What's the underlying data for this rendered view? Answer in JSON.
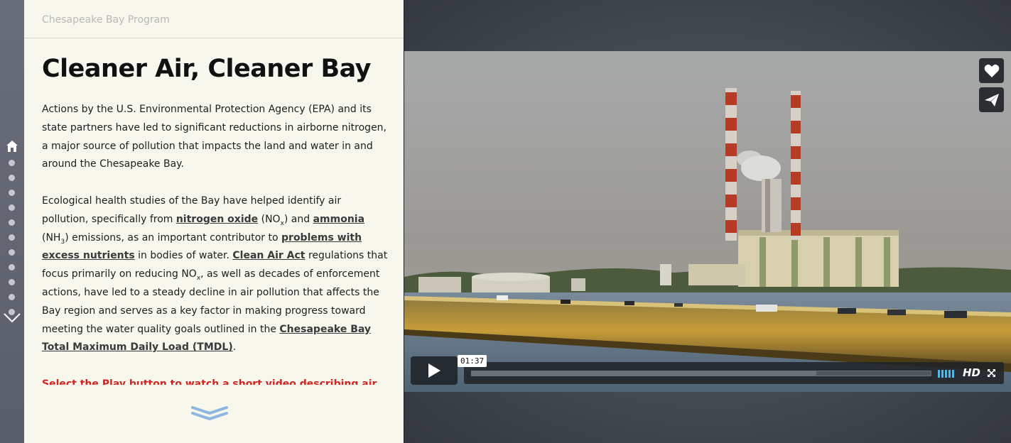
{
  "site": {
    "brand": "Chesapeake Bay Program"
  },
  "story": {
    "title": "Cleaner Air, Cleaner Bay",
    "p1": "Actions by the U.S. Environmental Protection Agency (EPA) and its state partners have led to significant reductions in airborne nitrogen, a major source of pollution that impacts the land and water in and around the Chesapeake Bay.",
    "p2": {
      "t1": "Ecological health studies of the Bay have helped identify air pollution, specifically from ",
      "link1": "nitrogen oxide",
      "t2": " (NO",
      "sub1": "x",
      "t3": ") and ",
      "link2": "ammonia",
      "t4": " (NH",
      "sub2": "3",
      "t5": ") emissions, as an important contributor to ",
      "link3": "problems with excess nutrients",
      "t6": " in bodies of water. ",
      "link4": "Clean Air Act",
      "t7": " regulations that focus primarily on reducing NO",
      "sub3": "x",
      "t8": ", as well as decades of enforcement actions, have led to a steady decline in air pollution that affects the Bay region and serves as a key factor in making progress toward meeting the water quality goals outlined in the ",
      "link5": "Chesapeake Bay Total Maximum Daily Load (TMDL)",
      "t9": "."
    },
    "cta": "Select the Play button to watch a short video describing air pollution and the Chesapeake Bay"
  },
  "nav": {
    "icons": {
      "home": "home-icon",
      "next": "chevron-down-icon",
      "more": "double-chevron-down-icon"
    },
    "dot_count": 11,
    "active_color": "#ffffff",
    "dot_color": "#c5c7d0"
  },
  "video": {
    "timecode": "01:37",
    "quality": "HD",
    "buffered_fraction": 0.75,
    "icons": {
      "like": "heart-icon",
      "share": "paper-plane-icon",
      "play": "play-icon",
      "volume": "volume-bars-icon",
      "fullscreen": "fullscreen-icon"
    }
  },
  "colors": {
    "accent_red": "#d3231f",
    "panel_bg": "#f8f7ee",
    "link": "#3a3a3a"
  }
}
